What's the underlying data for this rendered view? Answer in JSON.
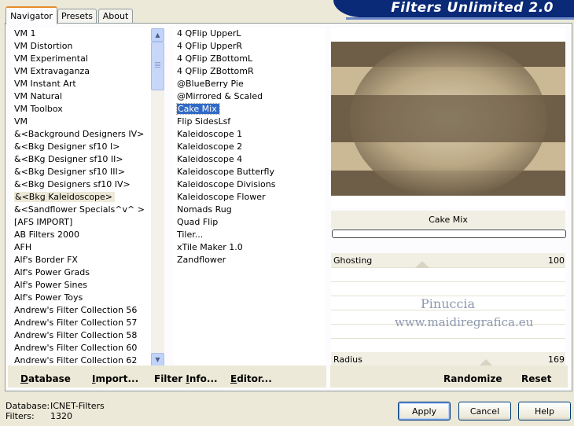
{
  "app": {
    "title": "Filters Unlimited 2.0"
  },
  "tabs": [
    {
      "label": "Navigator"
    },
    {
      "label": "Presets"
    },
    {
      "label": "About"
    }
  ],
  "categories": {
    "items": [
      "VM 1",
      "VM Distortion",
      "VM Experimental",
      "VM Extravaganza",
      "VM Instant Art",
      "VM Natural",
      "VM Toolbox",
      "VM",
      "&<Background Designers IV>",
      "&<Bkg Designer sf10 I>",
      "&<BKg Designer sf10 II>",
      "&<Bkg Designer sf10 III>",
      "&<Bkg Designers sf10 IV>",
      "&<Bkg Kaleidoscope>",
      "&<Sandflower Specials^v^ >",
      "[AFS IMPORT]",
      "AB Filters 2000",
      "AFH",
      "Alf's Border FX",
      "Alf's Power Grads",
      "Alf's Power Sines",
      "Alf's Power Toys",
      "Andrew's Filter Collection 56",
      "Andrew's Filter Collection 57",
      "Andrew's Filter Collection 58",
      "Andrew's Filter Collection 60",
      "Andrew's Filter Collection 62"
    ],
    "selected_index": 13
  },
  "filters": {
    "items": [
      "4 QFlip UpperL",
      "4 QFlip UpperR",
      "4 QFlip ZBottomL",
      "4 QFlip ZBottomR",
      "@BlueBerry Pie",
      "@Mirrored & Scaled",
      "Cake Mix",
      "Flip SidesLsf",
      "Kaleidoscope 1",
      "Kaleidoscope 2",
      "Kaleidoscope 4",
      "Kaleidoscope Butterfly",
      "Kaleidoscope Divisions",
      "Kaleidoscope Flower",
      "Nomads Rug",
      "Quad Flip",
      "Tiler...",
      "xTile Maker 1.0",
      "Zandflower"
    ],
    "selected_index": 6
  },
  "preview": {
    "filter_name": "Cake Mix",
    "colors": {
      "dark": "#6e5e48",
      "light": "#cbb894",
      "mid": "#a69272"
    }
  },
  "params": [
    {
      "label": "Ghosting",
      "value": "100",
      "level_fraction": 0.39
    },
    {
      "label": "Radius",
      "value": "169",
      "level_fraction": 0.66
    }
  ],
  "watermark": {
    "line1": "Pinuccia",
    "line2": "www.maidiregrafica.eu"
  },
  "toolbar": {
    "database": {
      "u": "D",
      "rest": "atabase"
    },
    "import": {
      "u": "I",
      "rest": "mport..."
    },
    "filter_info": {
      "pre": "Filter ",
      "u": "I",
      "rest": "nfo..."
    },
    "editor": {
      "u": "E",
      "rest": "ditor..."
    },
    "randomize": "Randomize",
    "reset": "Reset"
  },
  "status": {
    "database_label": "Database:",
    "database_value": "ICNET-Filters",
    "filters_label": "Filters:",
    "filters_value": "1320"
  },
  "buttons": {
    "apply": "Apply",
    "cancel": "Cancel",
    "help": "Help"
  },
  "colors": {
    "accent": "#316ac5",
    "banner": "#0a2a78",
    "tab_highlight": "#e68b2c"
  }
}
